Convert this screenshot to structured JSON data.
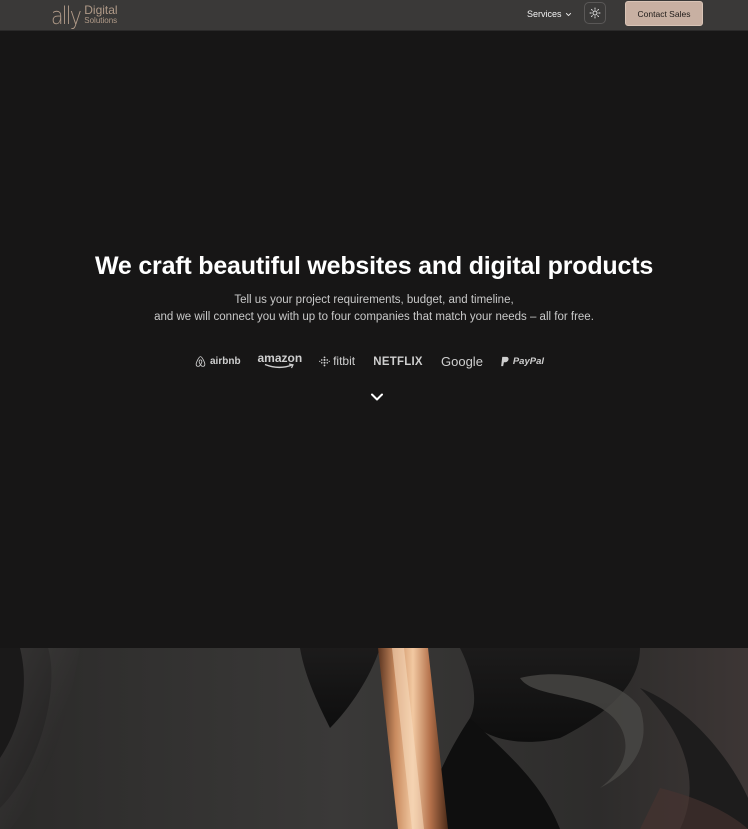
{
  "nav": {
    "logo_mark": "ally",
    "logo_word_1": "Digital",
    "logo_word_2": "Solutions",
    "services_label": "Services",
    "contact_label": "Contact Sales"
  },
  "hero": {
    "title": "We craft beautiful websites and digital products",
    "subtitle_line1": "Tell us your project requirements, budget, and timeline,",
    "subtitle_line2": "and we will connect you with up to four companies that match your needs – all for free."
  },
  "brands": {
    "airbnb": "airbnb",
    "amazon": "amazon",
    "fitbit": "fitbit",
    "netflix": "NETFLIX",
    "google": "Google",
    "paypal": "PayPal"
  },
  "colors": {
    "accent": "#c8b0a2",
    "background": "#171616",
    "navbar": "#3a3938"
  },
  "icons": {
    "services_chevron": "chevron-down-icon",
    "theme_toggle": "sun-icon",
    "scroll": "chevron-down-icon"
  }
}
